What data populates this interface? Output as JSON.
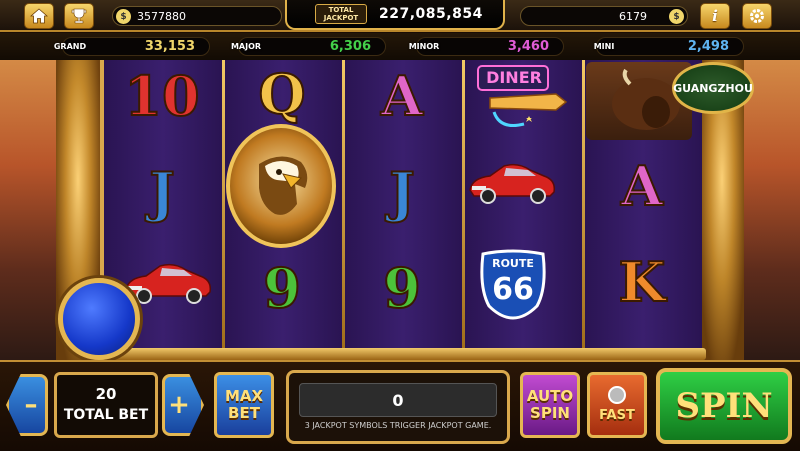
{
  "topbar": {
    "home_icon": "home-icon",
    "trophy_icon": "trophy-icon",
    "balance_left": "3577880",
    "total_jackpot_logo": "TOTAL JACKPOT",
    "total_jackpot_value": "227,085,854",
    "balance_right": "6179",
    "info_label": "i",
    "settings_icon": "gear-icon"
  },
  "jackpots": [
    {
      "label": "GRAND",
      "value": "33,153",
      "color": "#f0d66b"
    },
    {
      "label": "MAJOR",
      "value": "6,306",
      "color": "#44d04a"
    },
    {
      "label": "MINOR",
      "value": "3,460",
      "color": "#e05cd6"
    },
    {
      "label": "MINI",
      "value": "2,498",
      "color": "#5fb4f0"
    }
  ],
  "reels": {
    "reel1": [
      "10",
      "J",
      "car"
    ],
    "reel2": [
      "Q",
      "eagle",
      "9"
    ],
    "reel3": [
      "A",
      "J",
      "9"
    ],
    "reel4": [
      "diner",
      "car",
      "route66"
    ],
    "reel5": [
      "bison",
      "A",
      "K"
    ]
  },
  "symbols": {
    "diner_text": "DINER",
    "route_top": "ROUTE",
    "route_num": "66",
    "guangzhou": "GUANGZHOU"
  },
  "controls": {
    "minus_label": "–",
    "plus_label": "+",
    "bet_value": "20",
    "bet_label": "TOTAL BET",
    "maxbet_label": "MAX BET",
    "win_value": "0",
    "message": "3 JACKPOT SYMBOLS TRIGGER JACKPOT GAME.",
    "autospin_label": "AUTO SPIN",
    "fast_label": "FAST",
    "spin_label": "SPIN"
  }
}
